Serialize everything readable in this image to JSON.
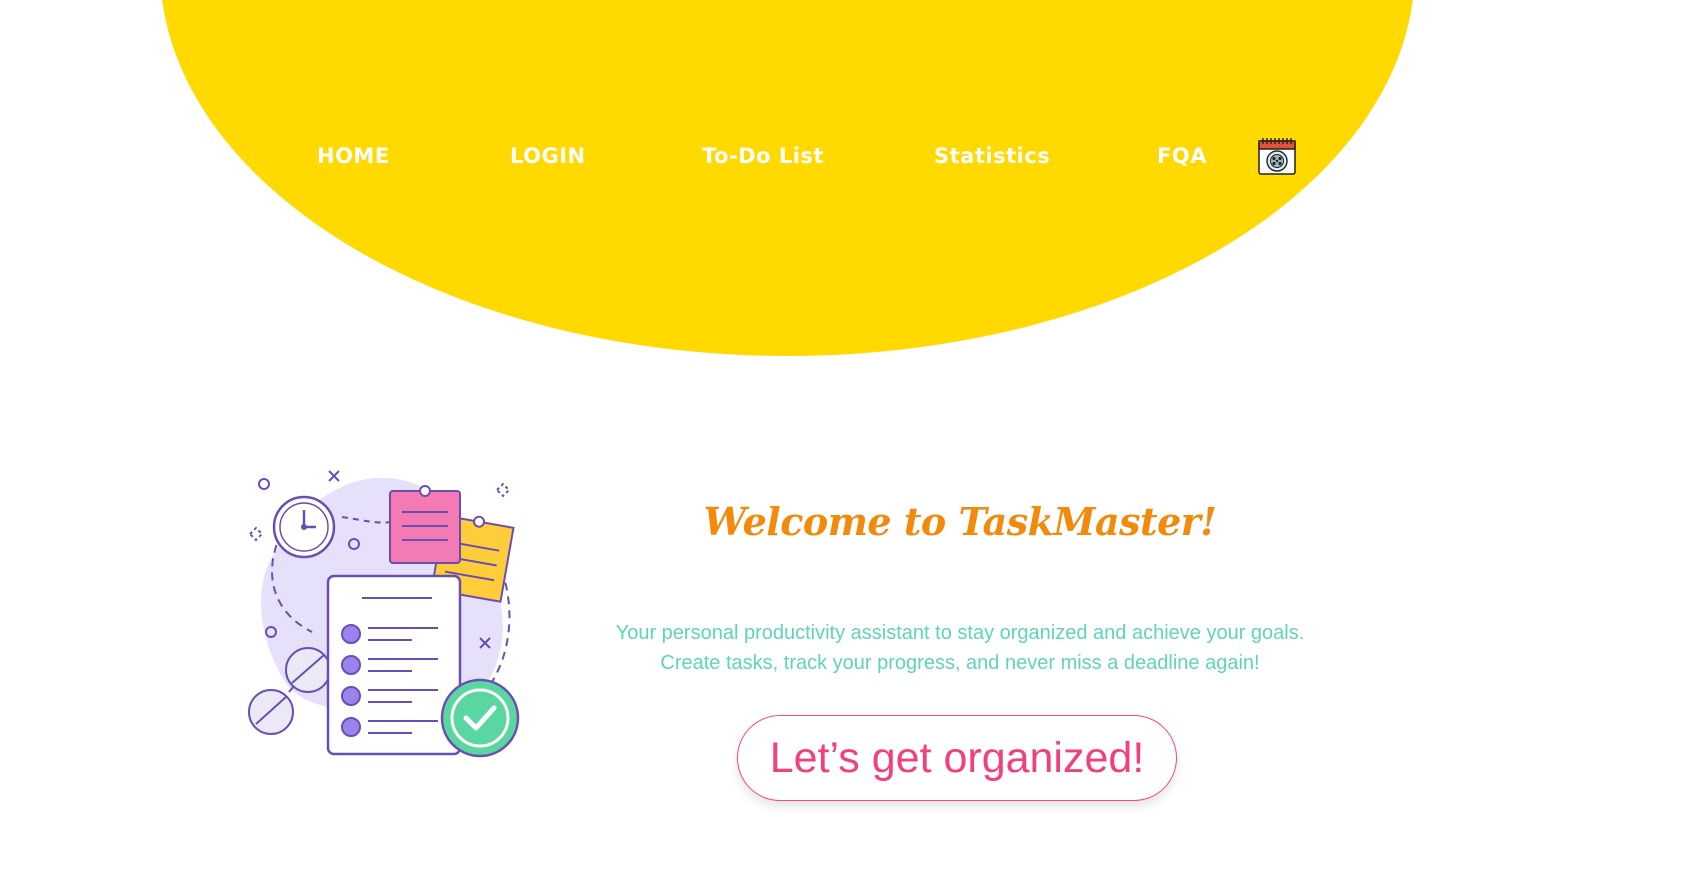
{
  "nav": {
    "home": "HOME",
    "login": "LOGIN",
    "todo": "To-Do List",
    "statistics": "Statistics",
    "fqa": "FQA",
    "calendar_icon": "calendar-icon"
  },
  "hero": {
    "title": "Welcome to TaskMaster!",
    "tagline_line1": "Your personal productivity assistant to stay organized and achieve your goals.",
    "tagline_line2": "Create tasks, track your progress, and never miss a deadline again!",
    "cta_label": "Let’s get organized!",
    "illustration_icon": "task-checklist-illustration"
  },
  "colors": {
    "header_yellow": "#ffd900",
    "nav_text": "#ffffff",
    "title_orange": "#f28a0c",
    "tagline_teal": "#5fd3bd",
    "cta_pink": "#f2407e",
    "illustration_purple": "#6a4fb3",
    "note_pink": "#f47ab4",
    "note_yellow": "#ffcd3a",
    "check_green": "#5ad6a0",
    "blob_lavender": "#e6e0fb"
  }
}
